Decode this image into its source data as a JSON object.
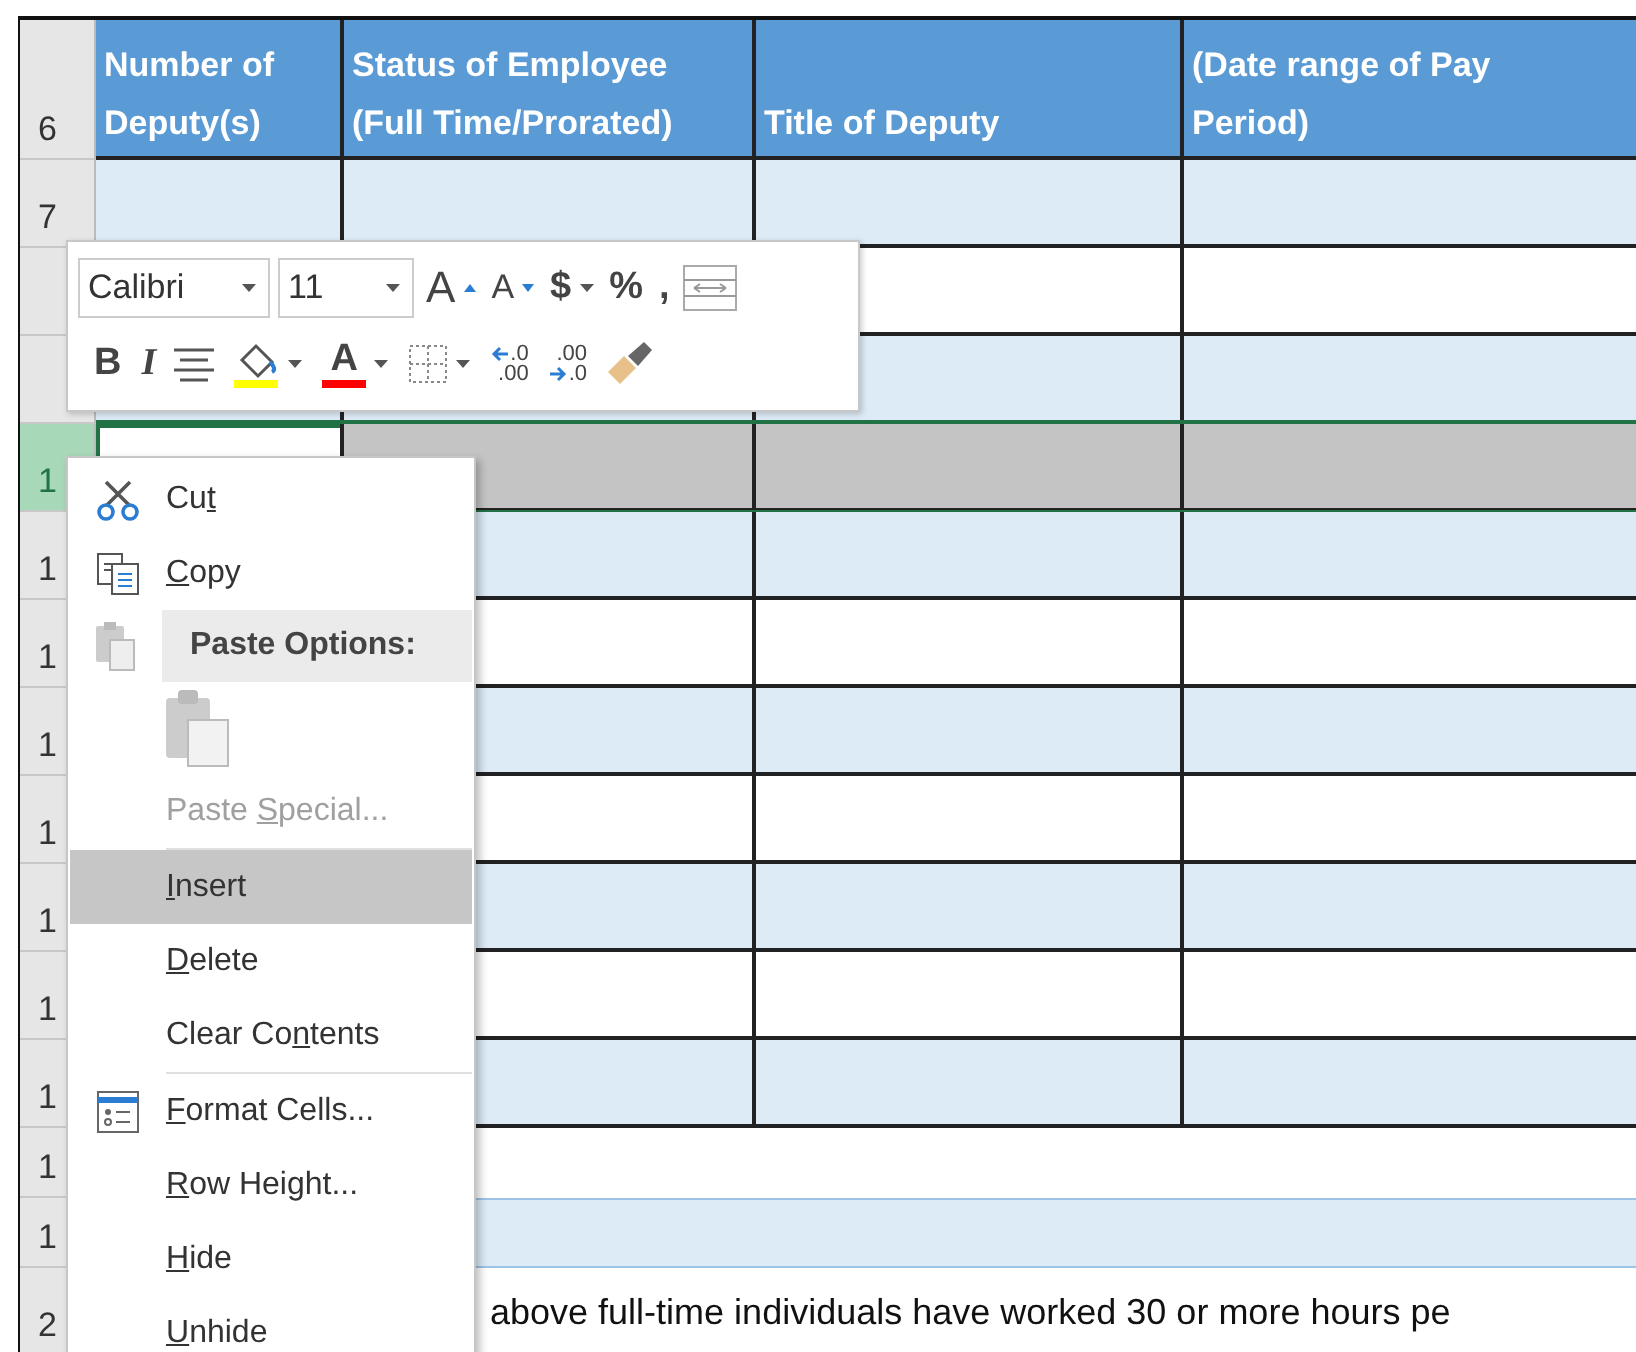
{
  "sheet": {
    "header_row": {
      "number": "6",
      "columns": [
        {
          "lines": [
            "Number of",
            "Deputy(s)"
          ]
        },
        {
          "lines": [
            "Status of Employee",
            "(Full Time/Prorated)"
          ]
        },
        {
          "lines": [
            "Title of Deputy"
          ]
        },
        {
          "lines": [
            "(Date range of Pay",
            "Period)"
          ]
        }
      ]
    },
    "rows": [
      {
        "kind": "table",
        "number": "7",
        "shaded": true,
        "selected": false
      },
      {
        "kind": "table",
        "number": "",
        "shaded": false,
        "selected": false
      },
      {
        "kind": "table",
        "number": "",
        "shaded": true,
        "selected": false
      },
      {
        "kind": "table",
        "number": "1",
        "selected": true,
        "active_cell": true
      },
      {
        "kind": "table",
        "number": "1",
        "shaded": true,
        "selected": false
      },
      {
        "kind": "table",
        "number": "1",
        "shaded": false,
        "selected": false
      },
      {
        "kind": "table",
        "number": "1",
        "shaded": true,
        "selected": false
      },
      {
        "kind": "table",
        "number": "1",
        "shaded": false,
        "selected": false
      },
      {
        "kind": "table",
        "number": "1",
        "shaded": true,
        "selected": false
      },
      {
        "kind": "table",
        "number": "1",
        "shaded": false,
        "selected": false
      },
      {
        "kind": "table",
        "number": "1",
        "shaded": true,
        "selected": false
      },
      {
        "kind": "blank",
        "number": "1"
      },
      {
        "kind": "band",
        "number": "1"
      },
      {
        "kind": "text",
        "number": "2",
        "text": "above full-time individuals have worked 30 or more hours pe"
      }
    ]
  },
  "mini_toolbar": {
    "font": "Calibri",
    "size": "11",
    "row_1": [
      {
        "kind": "grow_font",
        "glyph": "A"
      },
      {
        "kind": "shrink_font",
        "glyph": "A"
      },
      {
        "kind": "glyph",
        "glyph": "$",
        "dropdown": true
      },
      {
        "kind": "glyph",
        "glyph": "%",
        "dropdown": false
      },
      {
        "kind": "glyph",
        "glyph": ",",
        "dropdown": false
      },
      {
        "kind": "wrap"
      }
    ],
    "row_2": [
      {
        "kind": "glyph",
        "glyph": "B",
        "dropdown": false
      },
      {
        "kind": "italic",
        "glyph": "I",
        "dropdown": false
      },
      {
        "kind": "align"
      },
      {
        "kind": "fill_color",
        "color": "#ffff00",
        "dropdown": true
      },
      {
        "kind": "font_color",
        "glyph": "A",
        "color": "#ff0000",
        "dropdown": true
      },
      {
        "kind": "borders",
        "dropdown": true
      },
      {
        "kind": "increase_decimal",
        "top": ".0",
        "bottom": ".00"
      },
      {
        "kind": "decrease_decimal",
        "top": ".00",
        "bottom": ".0"
      },
      {
        "kind": "painter"
      }
    ]
  },
  "context_menu": {
    "items": [
      {
        "kind": "cut",
        "before": "Cu",
        "key": "t",
        "selected": false,
        "disabled": false
      },
      {
        "kind": "copy",
        "key": "C",
        "after": "opy",
        "selected": false,
        "disabled": false
      },
      {
        "kind": "paste_header",
        "before": "Paste Options:"
      },
      {
        "kind": "paste_button"
      },
      {
        "kind": "command",
        "before": "Paste ",
        "key": "S",
        "after": "pecial...",
        "selected": false,
        "disabled": true
      },
      {
        "kind": "separator"
      },
      {
        "kind": "command",
        "key": "I",
        "after": "nsert",
        "selected": true,
        "disabled": false
      },
      {
        "kind": "command",
        "key": "D",
        "after": "elete",
        "selected": false,
        "disabled": false
      },
      {
        "kind": "command",
        "before": "Clear Co",
        "key": "n",
        "after": "tents",
        "selected": false,
        "disabled": false
      },
      {
        "kind": "separator"
      },
      {
        "kind": "format_cells",
        "key": "F",
        "after": "ormat Cells...",
        "selected": false,
        "disabled": false
      },
      {
        "kind": "command",
        "key": "R",
        "after": "ow Height...",
        "selected": false,
        "disabled": false
      },
      {
        "kind": "command",
        "key": "H",
        "after": "ide",
        "selected": false,
        "disabled": false
      },
      {
        "kind": "command",
        "key": "U",
        "after": "nhide",
        "selected": false,
        "disabled": false
      }
    ]
  }
}
